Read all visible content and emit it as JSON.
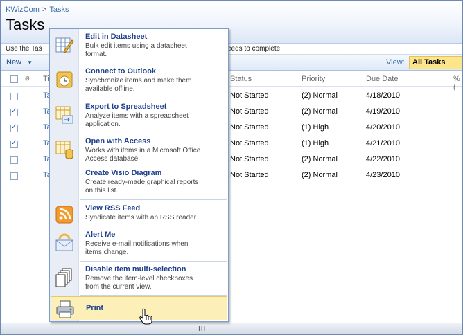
{
  "breadcrumb": {
    "site": "KWizCom",
    "separator": ">",
    "current": "Tasks"
  },
  "page": {
    "title": "Tasks",
    "description_left": "Use the Tas",
    "description_right": "eeds to complete."
  },
  "toolbar": {
    "new_label": "New",
    "view_label": "View:",
    "view_value": "All Tasks"
  },
  "columns": {
    "title": "Ti",
    "status": "Status",
    "priority": "Priority",
    "due": "Due Date",
    "pct": "% ("
  },
  "rows": [
    {
      "title": "Ta",
      "status": "Not Started",
      "priority": "(2) Normal",
      "due": "4/18/2010",
      "checked": false
    },
    {
      "title": "Ta",
      "status": "Not Started",
      "priority": "(2) Normal",
      "due": "4/19/2010",
      "checked": true
    },
    {
      "title": "Ta",
      "status": "Not Started",
      "priority": "(1) High",
      "due": "4/20/2010",
      "checked": true
    },
    {
      "title": "Ta",
      "status": "Not Started",
      "priority": "(1) High",
      "due": "4/21/2010",
      "checked": true
    },
    {
      "title": "Ta",
      "status": "Not Started",
      "priority": "(2) Normal",
      "due": "4/22/2010",
      "checked": false
    },
    {
      "title": "Ta",
      "status": "Not Started",
      "priority": "(2) Normal",
      "due": "4/23/2010",
      "checked": false
    }
  ],
  "menu": {
    "items": [
      {
        "title": "Edit in Datasheet",
        "desc1": "Bulk edit items using a datasheet",
        "desc2": "format.",
        "desc3": "",
        "icon": "datasheet-icon"
      },
      {
        "title": "Connect to Outlook",
        "desc1": "Synchronize items and make them",
        "desc2": "available offline.",
        "desc3": "",
        "icon": "outlook-icon"
      },
      {
        "title": "Export to Spreadsheet",
        "desc1": "Analyze items with a spreadsheet",
        "desc2": "application.",
        "desc3": "",
        "icon": "spreadsheet-icon"
      },
      {
        "title": "Open with Access",
        "desc1": "Works with items in a Microsoft Office",
        "desc2": "Access database.",
        "desc3": "",
        "icon": "access-icon"
      },
      {
        "title": "Create Visio Diagram",
        "desc1": "Create ready-made graphical reports",
        "desc2": "on this list.",
        "desc3": "",
        "icon": "visio-icon"
      },
      {
        "title": "View RSS Feed",
        "desc1": "Syndicate items with an RSS reader.",
        "desc2": "",
        "desc3": "",
        "icon": "rss-icon"
      },
      {
        "title": "Alert Me",
        "desc1": "Receive e-mail notifications when",
        "desc2": "items change.",
        "desc3": "",
        "icon": "alert-icon"
      },
      {
        "title": "Disable item multi-selection",
        "desc1": "Remove the item-level checkboxes",
        "desc2": "from the current view.",
        "desc3": "",
        "icon": "multi-select-icon"
      },
      {
        "title": "Print",
        "desc1": "",
        "desc2": "",
        "desc3": "",
        "icon": "printer-icon"
      }
    ]
  },
  "scrollbar": {
    "grip": "III"
  },
  "colors": {
    "link": "#3b6ea8",
    "menu_title": "#1e3f8c",
    "highlight": "#fcefb8",
    "view_select": "#fde58a"
  }
}
